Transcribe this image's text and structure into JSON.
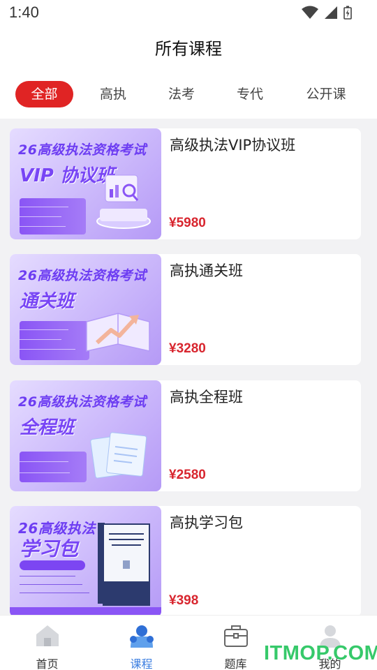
{
  "status_bar": {
    "time": "1:40"
  },
  "header": {
    "title": "所有课程"
  },
  "tabs": [
    {
      "label": "全部",
      "active": true
    },
    {
      "label": "高执",
      "active": false
    },
    {
      "label": "法考",
      "active": false
    },
    {
      "label": "专代",
      "active": false
    },
    {
      "label": "公开课",
      "active": false
    }
  ],
  "courses": [
    {
      "title": "高级执法VIP协议班",
      "price": "¥5980",
      "image_headline": "26高级执法资格考试",
      "image_subtitle": "VIP 协议班"
    },
    {
      "title": "高执通关班",
      "price": "¥3280",
      "image_headline": "26高级执法资格考试",
      "image_subtitle": "通关班"
    },
    {
      "title": "高执全程班",
      "price": "¥2580",
      "image_headline": "26高级执法资格考试",
      "image_subtitle": "全程班"
    },
    {
      "title": "高执学习包",
      "price": "¥398",
      "image_headline": "26高级执法",
      "image_subtitle": "学习包"
    }
  ],
  "bottom_nav": [
    {
      "label": "首页",
      "icon": "home-icon",
      "active": false
    },
    {
      "label": "课程",
      "icon": "course-icon",
      "active": true
    },
    {
      "label": "题库",
      "icon": "question-bank-icon",
      "active": false
    },
    {
      "label": "我的",
      "icon": "profile-icon",
      "active": false
    }
  ],
  "watermark": "ITMOP.COM",
  "colors": {
    "accent_red": "#e02424",
    "price_red": "#d8262f",
    "nav_active_blue": "#3a7de0",
    "thumb_purple": "#7845f5"
  }
}
